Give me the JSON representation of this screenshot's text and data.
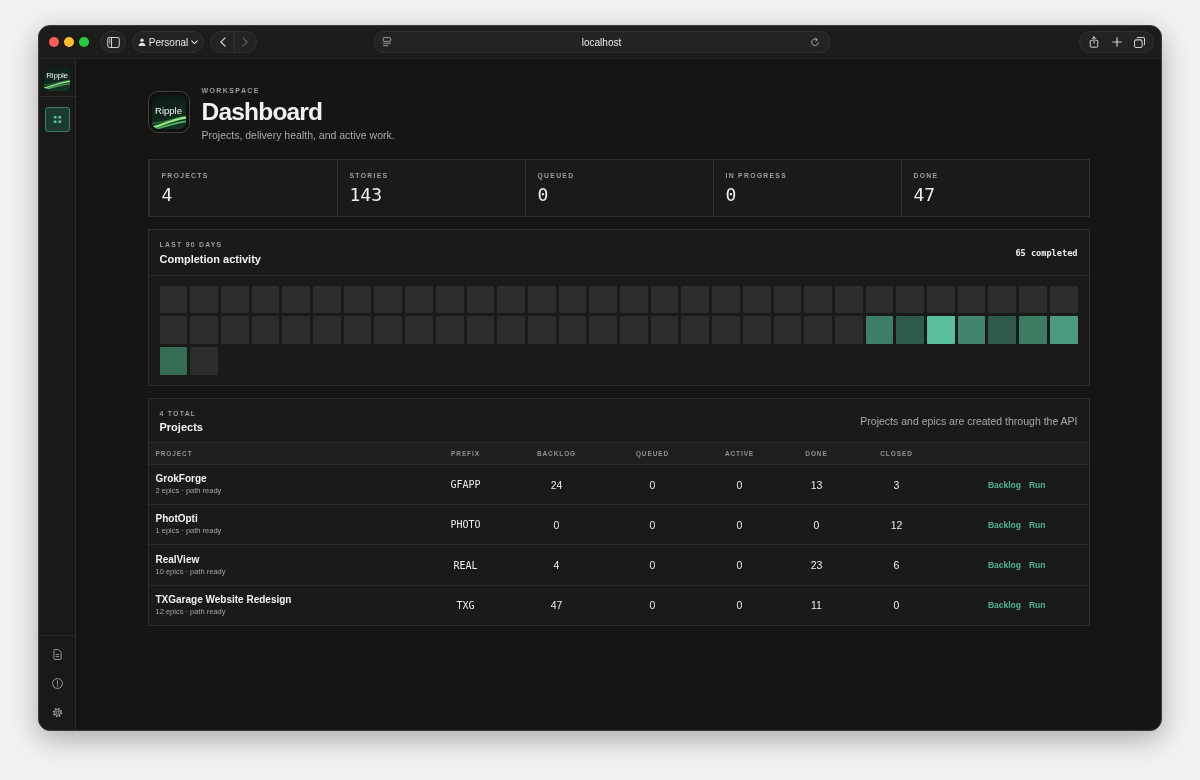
{
  "browser": {
    "profile": "Personal",
    "history": [
      {
        "kind": "back",
        "disabled": false
      },
      {
        "kind": "forward",
        "disabled": true
      }
    ],
    "url": "localhost"
  },
  "sidebar": {
    "logo_text": "Ripple",
    "nav_items": [
      {
        "selected": true
      }
    ]
  },
  "header": {
    "logo_text": "Ripple",
    "eyebrow": "WORKSPACE",
    "title": "Dashboard",
    "subtitle": "Projects, delivery health, and active work."
  },
  "stats": [
    {
      "label": "PROJECTS",
      "value": "4"
    },
    {
      "label": "STORIES",
      "value": "143"
    },
    {
      "label": "QUEUED",
      "value": "0"
    },
    {
      "label": "IN PROGRESS",
      "value": "0"
    },
    {
      "label": "DONE",
      "value": "47"
    }
  ],
  "activity": {
    "eyebrow": "LAST 90 DAYS",
    "title": "Completion activity",
    "summary": "65 completed",
    "cells": [
      {
        "color": "#2a2d29"
      },
      {
        "color": "#2a2d29"
      },
      {
        "color": "#2a2d29"
      },
      {
        "color": "#2a2d29"
      },
      {
        "color": "#2a2d29"
      },
      {
        "color": "#2a2d29"
      },
      {
        "color": "#2a2d29"
      },
      {
        "color": "#2a2d29"
      },
      {
        "color": "#2a2d29"
      },
      {
        "color": "#2a2d29"
      },
      {
        "color": "#2a2d29"
      },
      {
        "color": "#2a2d29"
      },
      {
        "color": "#2a2d29"
      },
      {
        "color": "#2a2d29"
      },
      {
        "color": "#2a2d29"
      },
      {
        "color": "#2a2d29"
      },
      {
        "color": "#2a2d29"
      },
      {
        "color": "#2a2d29"
      },
      {
        "color": "#2a2d29"
      },
      {
        "color": "#2a2d29"
      },
      {
        "color": "#2a2d29"
      },
      {
        "color": "#2a2d29"
      },
      {
        "color": "#2a2d29"
      },
      {
        "color": "#2a2d29"
      },
      {
        "color": "#2a2d29"
      },
      {
        "color": "#2a2d29"
      },
      {
        "color": "#2a2d29"
      },
      {
        "color": "#2a2d29"
      },
      {
        "color": "#2a2d29"
      },
      {
        "color": "#2a2d29"
      },
      {
        "color": "#2a2d29"
      },
      {
        "color": "#2a2d29"
      },
      {
        "color": "#2a2d29"
      },
      {
        "color": "#2a2d29"
      },
      {
        "color": "#2a2d29"
      },
      {
        "color": "#2a2d29"
      },
      {
        "color": "#2a2d29"
      },
      {
        "color": "#2a2d29"
      },
      {
        "color": "#2a2d29"
      },
      {
        "color": "#2a2d29"
      },
      {
        "color": "#2a2d29"
      },
      {
        "color": "#2a2d29"
      },
      {
        "color": "#2a2d29"
      },
      {
        "color": "#2a2d29"
      },
      {
        "color": "#2a2d29"
      },
      {
        "color": "#2a2d29"
      },
      {
        "color": "#2a2d29"
      },
      {
        "color": "#2a2d29"
      },
      {
        "color": "#2a2d29"
      },
      {
        "color": "#2a2d29"
      },
      {
        "color": "#2a2d29"
      },
      {
        "color": "#2a2d29"
      },
      {
        "color": "#2a2d29"
      },
      {
        "color": "#3f7d66"
      },
      {
        "color": "#2e5a4a"
      },
      {
        "color": "#5cbf9c"
      },
      {
        "color": "#438470"
      },
      {
        "color": "#2f5a49"
      },
      {
        "color": "#3e7b63"
      },
      {
        "color": "#4e9a80"
      },
      {
        "color": "#366b56"
      },
      {
        "color": "#2a2d29"
      }
    ]
  },
  "projects": {
    "eyebrow": "4 TOTAL",
    "title": "Projects",
    "note": "Projects and epics are created through the API",
    "columns": [
      "PROJECT",
      "PREFIX",
      "BACKLOG",
      "QUEUED",
      "ACTIVE",
      "DONE",
      "CLOSED"
    ],
    "rows": [
      {
        "name": "GrokForge",
        "meta": "2 epics · path ready",
        "prefix": "GFAPP",
        "backlog": "24",
        "queued": "0",
        "active": "0",
        "done": "13",
        "closed": "3",
        "actions": [
          "Backlog",
          "Run"
        ]
      },
      {
        "name": "PhotOpti",
        "meta": "1 epics · path ready",
        "prefix": "PHOTO",
        "backlog": "0",
        "queued": "0",
        "active": "0",
        "done": "0",
        "closed": "12",
        "actions": [
          "Backlog",
          "Run"
        ]
      },
      {
        "name": "RealView",
        "meta": "10 epics · path ready",
        "prefix": "REAL",
        "backlog": "4",
        "queued": "0",
        "active": "0",
        "done": "23",
        "closed": "6",
        "actions": [
          "Backlog",
          "Run"
        ]
      },
      {
        "name": "TXGarage Website Redesign",
        "meta": "12 epics · path ready",
        "prefix": "TXG",
        "backlog": "47",
        "queued": "0",
        "active": "0",
        "done": "11",
        "closed": "0",
        "actions": [
          "Backlog",
          "Run"
        ]
      }
    ]
  }
}
